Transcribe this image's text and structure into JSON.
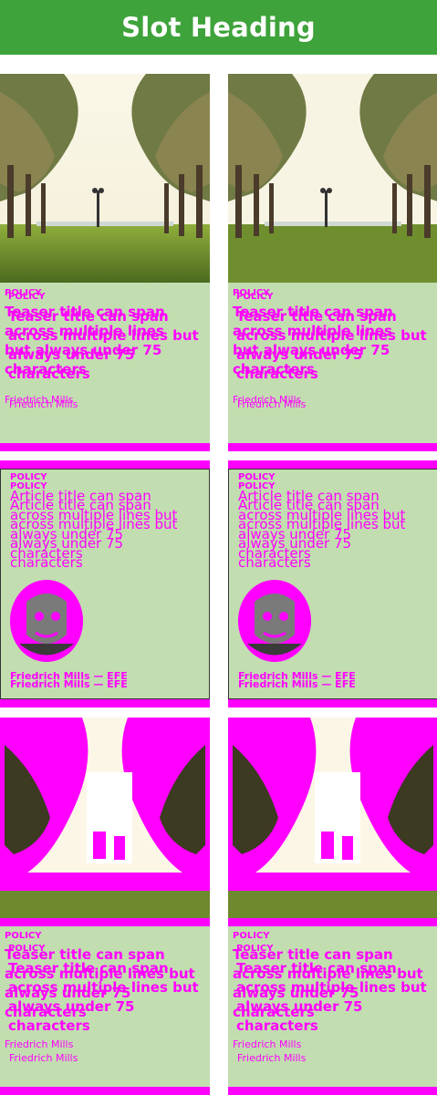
{
  "header": {
    "title": "Slot Heading"
  },
  "colors": {
    "accent": "#3ea33a",
    "card_bg": "#c2ddb0",
    "magenta": "#ff00ff"
  },
  "teaser": {
    "label": "POLICY",
    "title": "Teaser title can span across multiple lines but always under 75 characters",
    "byline": "Friedrich Mills"
  },
  "article": {
    "label": "POLICY",
    "title": "Article title can span across multiple lines but always under 75 characters",
    "byline": "Friedrich Mills — EFE",
    "avatar_icon": "author-portrait"
  }
}
